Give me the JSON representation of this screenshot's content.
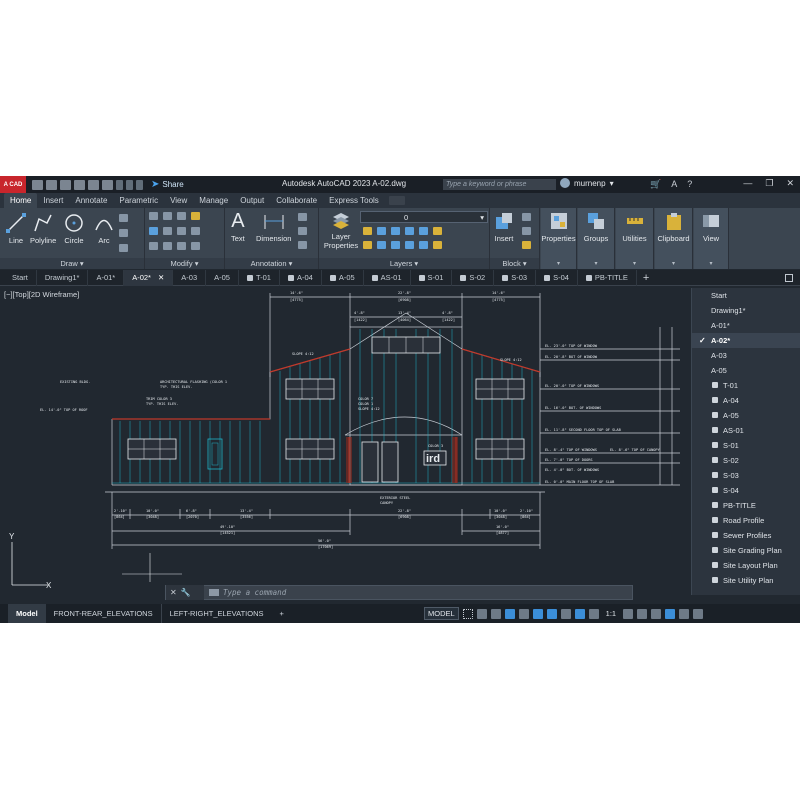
{
  "window": {
    "logo_text": "A CAD",
    "title": "Autodesk AutoCAD 2023   A-02.dwg",
    "share_label": "Share",
    "search_placeholder": "Type a keyword or phrase",
    "username": "murnenp",
    "controls": [
      "—",
      "❐",
      "✕"
    ]
  },
  "ribbon_tabs": [
    "Home",
    "Insert",
    "Annotate",
    "Parametric",
    "View",
    "Manage",
    "Output",
    "Collaborate",
    "Express Tools"
  ],
  "ribbon": {
    "draw": {
      "title": "Draw ▾",
      "tools": [
        "Line",
        "Polyline",
        "Circle",
        "Arc"
      ]
    },
    "modify": {
      "title": "Modify ▾"
    },
    "annotation": {
      "title": "Annotation ▾",
      "tools": [
        "Text",
        "Dimension"
      ]
    },
    "layers": {
      "title": "Layers ▾",
      "layer_props": "Layer Properties",
      "current_layer": "0"
    },
    "block": {
      "title": "Block ▾",
      "insert": "Insert"
    },
    "big_buttons": [
      "Properties",
      "Groups",
      "Utilities",
      "Clipboard",
      "View"
    ]
  },
  "doc_tabs": [
    {
      "label": "Start",
      "locked": false,
      "active": false
    },
    {
      "label": "Drawing1*",
      "locked": false,
      "active": false
    },
    {
      "label": "A-01*",
      "locked": false,
      "active": false
    },
    {
      "label": "A-02*",
      "locked": false,
      "active": true
    },
    {
      "label": "A-03",
      "locked": false,
      "active": false
    },
    {
      "label": "A-05",
      "locked": false,
      "active": false
    },
    {
      "label": "T-01",
      "locked": true,
      "active": false
    },
    {
      "label": "A-04",
      "locked": true,
      "active": false
    },
    {
      "label": "A-05",
      "locked": true,
      "active": false
    },
    {
      "label": "AS-01",
      "locked": true,
      "active": false
    },
    {
      "label": "S-01",
      "locked": true,
      "active": false
    },
    {
      "label": "S-02",
      "locked": true,
      "active": false
    },
    {
      "label": "S-03",
      "locked": true,
      "active": false
    },
    {
      "label": "S-04",
      "locked": true,
      "active": false
    },
    {
      "label": "PB-TITLE",
      "locked": true,
      "active": false
    }
  ],
  "viewport_label": "[−][Top][2D Wireframe]",
  "file_menu": [
    {
      "label": "Start",
      "locked": false,
      "checked": false
    },
    {
      "label": "Drawing1*",
      "locked": false,
      "checked": false
    },
    {
      "label": "A-01*",
      "locked": false,
      "checked": false
    },
    {
      "label": "A-02*",
      "locked": false,
      "checked": true
    },
    {
      "label": "A-03",
      "locked": false,
      "checked": false
    },
    {
      "label": "A-05",
      "locked": false,
      "checked": false
    },
    {
      "label": "T-01",
      "locked": true,
      "checked": false
    },
    {
      "label": "A-04",
      "locked": true,
      "checked": false
    },
    {
      "label": "A-05",
      "locked": true,
      "checked": false
    },
    {
      "label": "AS-01",
      "locked": true,
      "checked": false
    },
    {
      "label": "S-01",
      "locked": true,
      "checked": false
    },
    {
      "label": "S-02",
      "locked": true,
      "checked": false
    },
    {
      "label": "S-03",
      "locked": true,
      "checked": false
    },
    {
      "label": "S-04",
      "locked": true,
      "checked": false
    },
    {
      "label": "PB-TITLE",
      "locked": true,
      "checked": false
    },
    {
      "label": "Road Profile",
      "locked": true,
      "checked": false
    },
    {
      "label": "Sewer Profiles",
      "locked": true,
      "checked": false
    },
    {
      "label": "Site Grading Plan",
      "locked": true,
      "checked": false
    },
    {
      "label": "Site Layout Plan",
      "locked": true,
      "checked": false
    },
    {
      "label": "Site Utility Plan",
      "locked": true,
      "checked": false
    }
  ],
  "drawing_annotations": {
    "dims_top": [
      "14'-6\"",
      "22'-8\"",
      "14'-6\""
    ],
    "dims_top_sub": [
      "[4775]",
      "[6908]",
      "[4775]"
    ],
    "dims_top2": [
      "4'-8\"",
      "13'-4\"",
      "4'-8\""
    ],
    "dims_top2_sub": [
      "[1422]",
      "[4064]",
      "[1422]"
    ],
    "slope_left": "SLOPE 4:12",
    "slope_right": "SLOPE 4:12",
    "existing_bldg": "EXISTING BLDG.",
    "arch_fl": "ARCHITECTURAL FLASHING (COLOR 1",
    "arch_fl2": "TYP. THIS ELEV.",
    "trim_color": "TRIM COLOR 3",
    "trim_color2": "TYP. THIS ELEV.",
    "roof_el": "EL. 14'-0\"  TOP OF ROOF",
    "color7": "COLOR 7",
    "color1": "COLOR 1",
    "slope_mid": "SLOPE 4:12",
    "color3": "COLOR 3",
    "sign_text": "ird",
    "el_lines": [
      "EL. 23'-0\"  TOP OF WINDOW",
      "EL. 20'-8\"  BOT OF WINDOW",
      "EL. 20'-0\"  TOP OF WINDOWS",
      "EL. 16'-0\"  BOT. OF WINDOWS",
      "EL. 11'-8\"  SECOND FLOOR TOP OF SLAB",
      "EL. 8'-4\"  TOP OF WINDOWS",
      "EL. 7'-0\"  TOP OF DOORS",
      "EL. 4'-0\"  BOT. OF WINDOWS",
      "EL. 0'-0\"  MAIN FLOOR TOP OF SLAB"
    ],
    "canopy": "EL. 8'-6\"  TOP OF CANOPY",
    "steel_canopy": "EXTERIOR STEEL",
    "steel_canopy2": "CANOPY",
    "dims_bottom": [
      "2'-10\"",
      "10'-0\"",
      "6'-8\"",
      "13'-4\"",
      "22'-8\"",
      "10'-0\"",
      "2'-10\""
    ],
    "dims_bottom_sub": [
      "[864]",
      "[3048]",
      "[2070]",
      "[3556]",
      "[6908]",
      "[3048]",
      "[864]"
    ],
    "dim_total_left": "49'-10\"",
    "dim_total_left_sub": "[14521]",
    "dim_total_right": "16'-0\"",
    "dim_total_right_sub": "[4877]",
    "dim_grand": "56'-0\"",
    "dim_grand_sub": "[17069]"
  },
  "command_placeholder": "Type a command",
  "layout_tabs": [
    "Model",
    "FRONT-REAR_ELEVATIONS",
    "LEFT-RIGHT_ELEVATIONS"
  ],
  "status": {
    "model_label": "MODEL",
    "scale": "1:1"
  },
  "colors": {
    "accent": "#3b8ed8",
    "cad_line": "#c9ced6",
    "cad_cyan": "#1eb3c9",
    "cad_red": "#c0392b",
    "title_red": "#c8252c"
  }
}
